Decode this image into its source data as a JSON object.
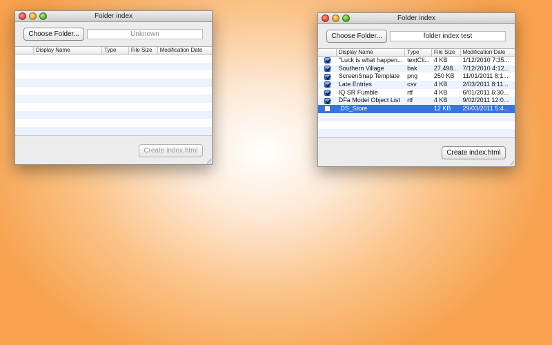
{
  "windows": [
    {
      "title": "Folder index",
      "choose_label": "Choose Folder...",
      "path_value": "Unknown",
      "create_label": "Create index.html",
      "columns": [
        "Display Name",
        "Type",
        "File Size",
        "Modification Date"
      ],
      "rows": []
    },
    {
      "title": "Folder index",
      "choose_label": "Choose Folder...",
      "path_value": "folder index test",
      "create_label": "Create index.html",
      "columns": [
        "Display Name",
        "Type",
        "File Size",
        "Modification Date"
      ],
      "rows": [
        {
          "checked": true,
          "name": "\"Luck is what happen...",
          "type": "textCli...",
          "size": "4 KB",
          "date": "1/12/2010 7:35...",
          "selected": false
        },
        {
          "checked": true,
          "name": "Southern Village",
          "type": "bak",
          "size": "27,498...",
          "date": "7/12/2010 4:12...",
          "selected": false
        },
        {
          "checked": true,
          "name": "ScreenSnap Template",
          "type": "png",
          "size": "250 KB",
          "date": "11/01/2011 8:1...",
          "selected": false
        },
        {
          "checked": true,
          "name": "Late Entries",
          "type": "csv",
          "size": "4 KB",
          "date": "2/03/2011 8:11...",
          "selected": false
        },
        {
          "checked": true,
          "name": "IQ SR Fumble",
          "type": "rtf",
          "size": "4 KB",
          "date": "6/01/2011 6:30...",
          "selected": false
        },
        {
          "checked": true,
          "name": "DFa Model Object List",
          "type": "rtf",
          "size": "4 KB",
          "date": "9/02/2011 12:0...",
          "selected": false
        },
        {
          "checked": false,
          "name": ".DS_Store",
          "type": "",
          "size": "12 KB",
          "date": "29/03/2011 5:4...",
          "selected": true
        }
      ]
    }
  ]
}
